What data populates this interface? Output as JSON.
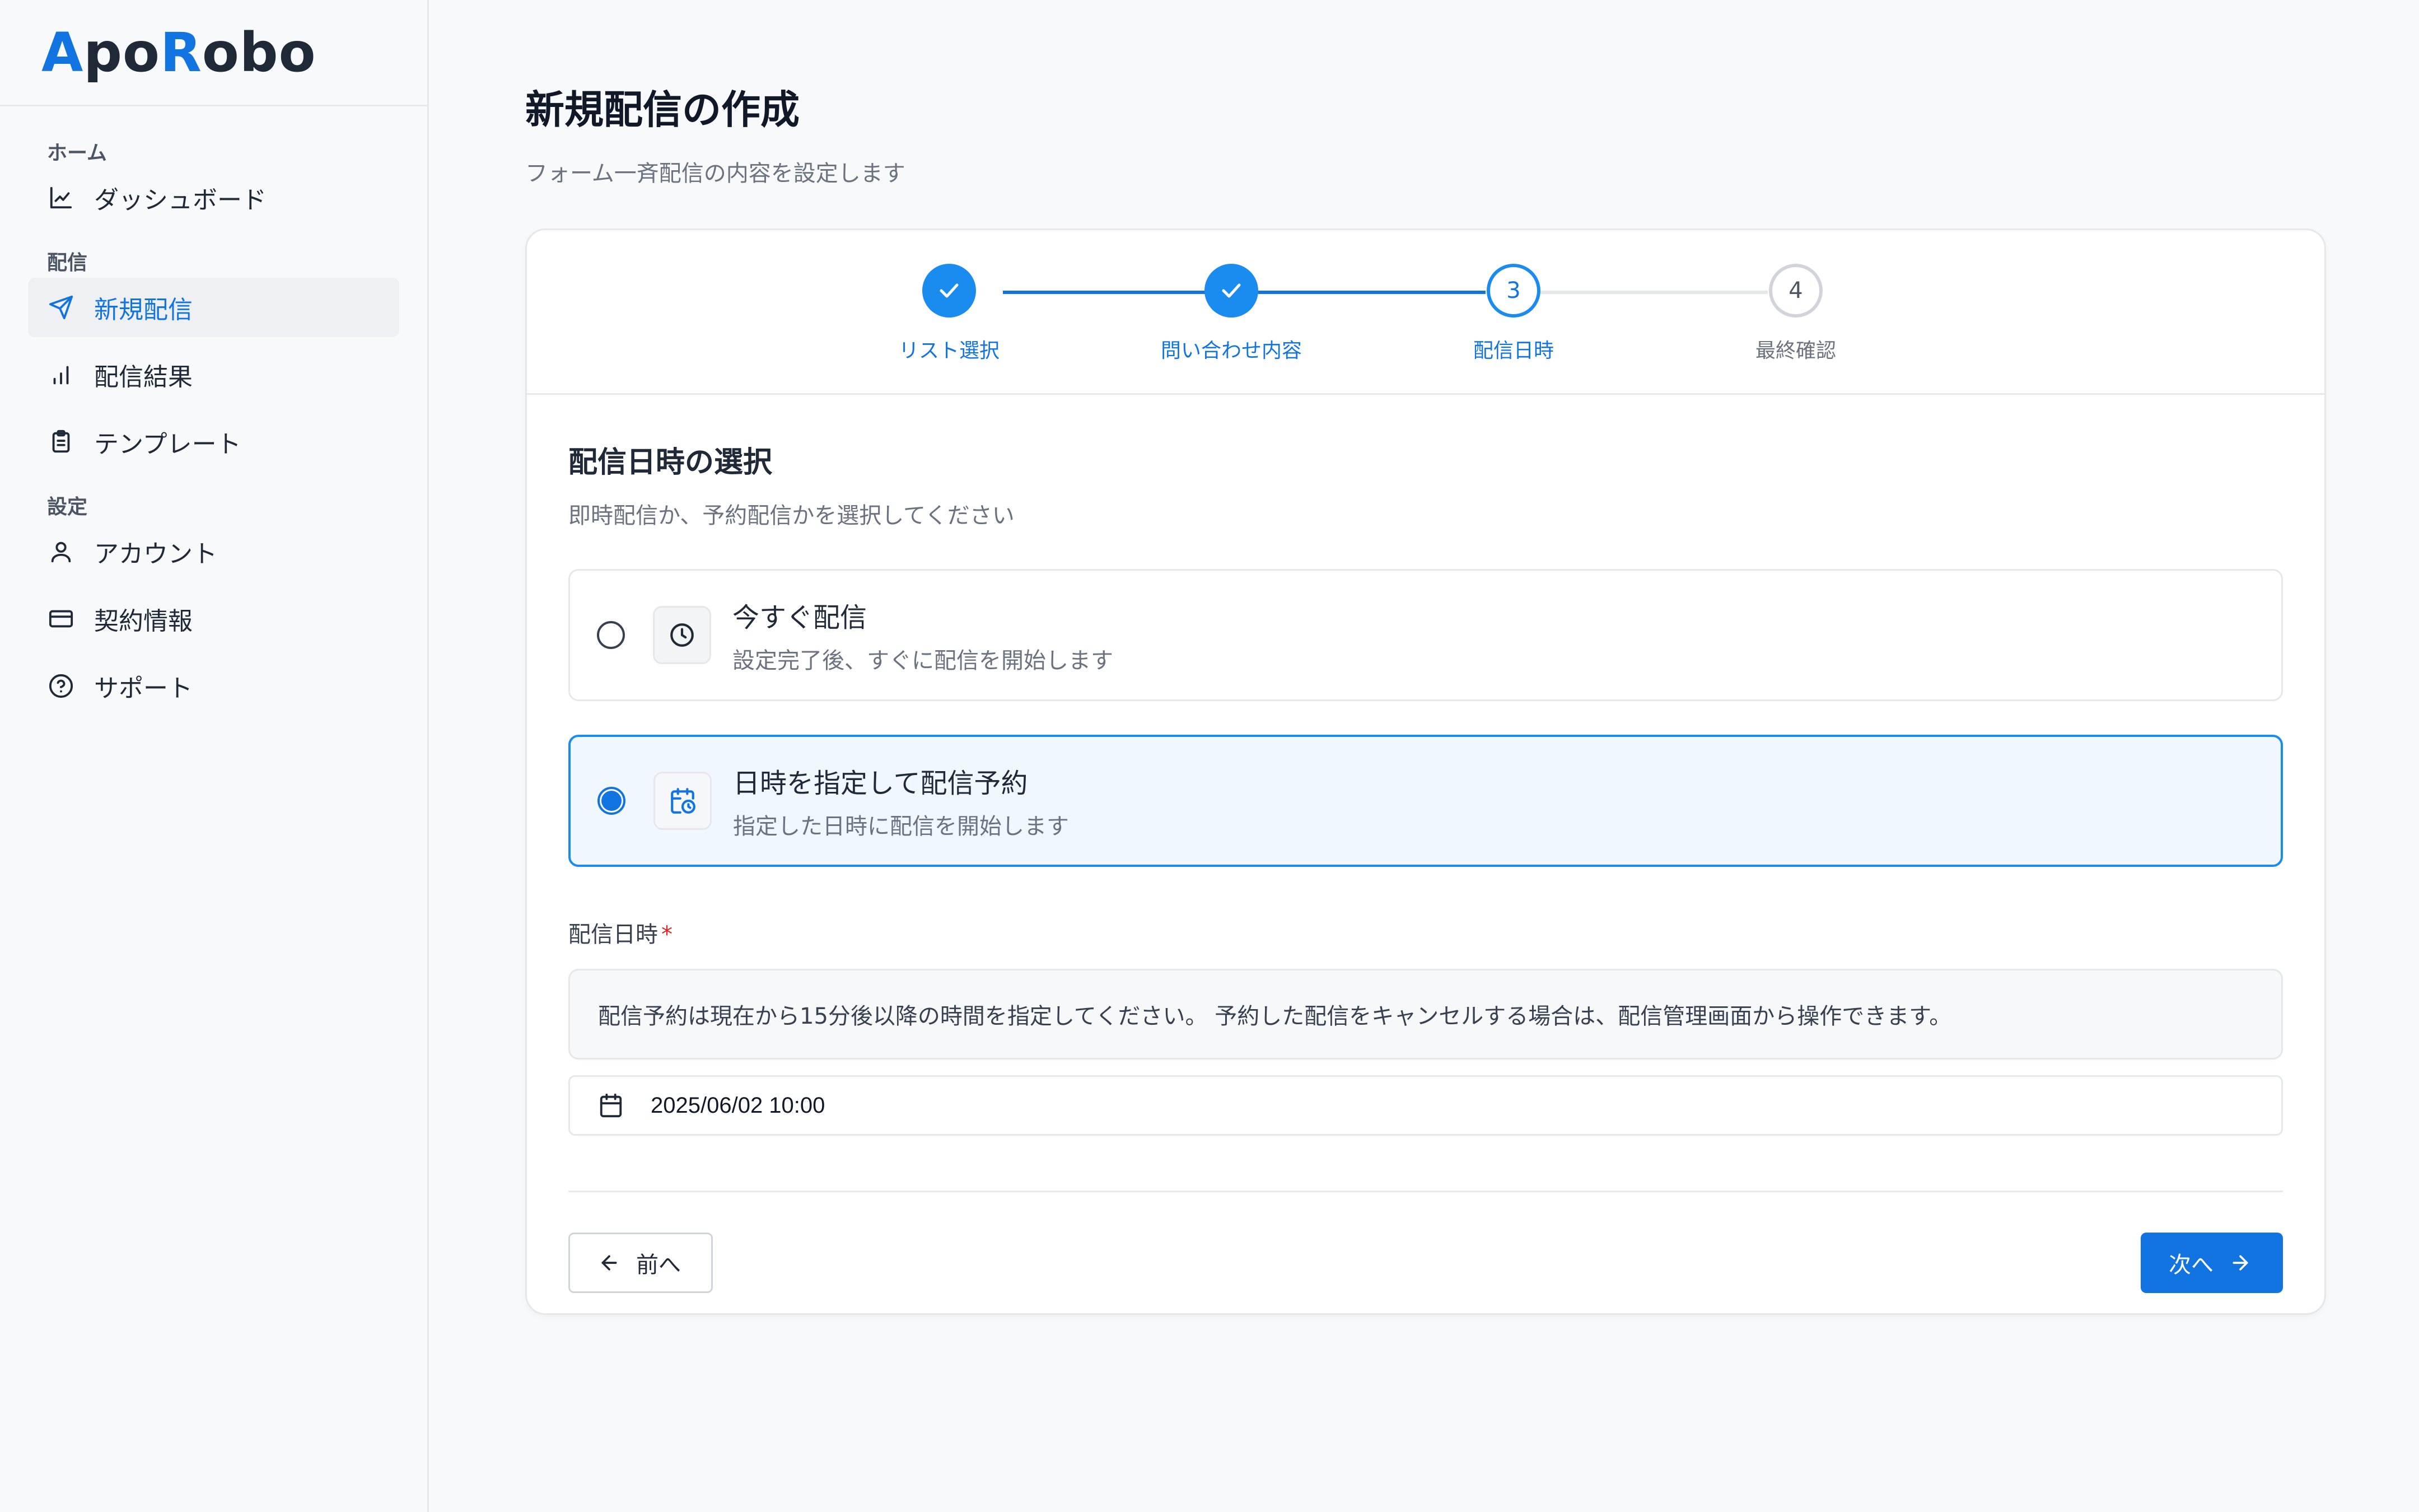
{
  "brand": {
    "logo_a": "A",
    "logo_po": "po",
    "logo_r": "R",
    "logo_obo": "obo"
  },
  "sidebar": {
    "sections": [
      {
        "heading": "ホーム",
        "items": [
          {
            "label": "ダッシュボード",
            "icon": "chart-line-icon"
          }
        ]
      },
      {
        "heading": "配信",
        "items": [
          {
            "label": "新規配信",
            "icon": "send-icon",
            "active": true
          },
          {
            "label": "配信結果",
            "icon": "bar-chart-icon"
          },
          {
            "label": "テンプレート",
            "icon": "clipboard-icon"
          }
        ]
      },
      {
        "heading": "設定",
        "items": [
          {
            "label": "アカウント",
            "icon": "user-icon"
          },
          {
            "label": "契約情報",
            "icon": "credit-card-icon"
          },
          {
            "label": "サポート",
            "icon": "help-circle-icon"
          }
        ]
      }
    ]
  },
  "page": {
    "title": "新規配信の作成",
    "subtitle": "フォーム一斉配信の内容を設定します"
  },
  "stepper": {
    "steps": [
      {
        "number": "1",
        "label": "リスト選択",
        "state": "done"
      },
      {
        "number": "2",
        "label": "問い合わせ内容",
        "state": "done"
      },
      {
        "number": "3",
        "label": "配信日時",
        "state": "current"
      },
      {
        "number": "4",
        "label": "最終確認",
        "state": "pending"
      }
    ]
  },
  "schedule": {
    "title": "配信日時の選択",
    "description": "即時配信か、予約配信かを選択してください",
    "options": [
      {
        "title": "今すぐ配信",
        "description": "設定完了後、すぐに配信を開始します",
        "icon": "clock-icon",
        "selected": false
      },
      {
        "title": "日時を指定して配信予約",
        "description": "指定した日時に配信を開始します",
        "icon": "calendar-clock-icon",
        "selected": true
      }
    ],
    "field_label": "配信日時",
    "required_mark": "*",
    "notice": "配信予約は現在から15分後以降の時間を指定してください。 予約した配信をキャンセルする場合は、配信管理画面から操作できます。",
    "datetime_value": "2025/06/02 10:00"
  },
  "actions": {
    "prev_label": "前へ",
    "next_label": "次へ"
  },
  "colors": {
    "accent": "#1274e0",
    "accent_light": "#1a8cf0",
    "selected_bg": "#f0f7ff",
    "required": "#dc2626"
  }
}
